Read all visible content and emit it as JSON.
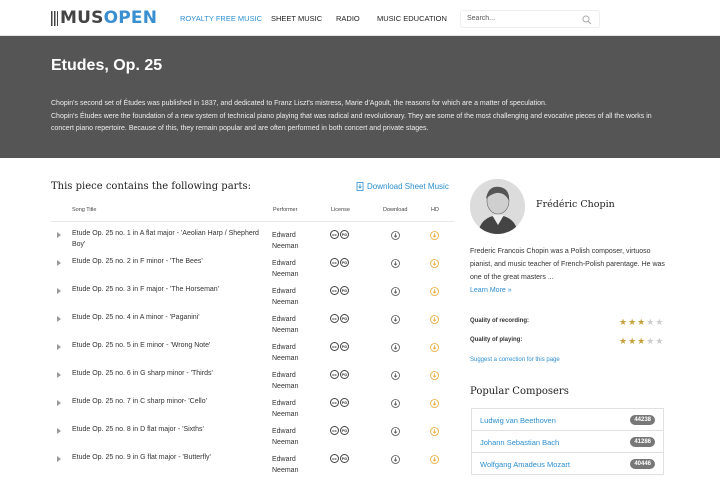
{
  "header": {
    "logo_primary": "MUS",
    "logo_accent": "OPEN",
    "nav": [
      "ROYALTY FREE MUSIC",
      "SHEET MUSIC",
      "RADIO",
      "MUSIC EDUCATION"
    ],
    "search_placeholder": "Search..."
  },
  "hero": {
    "title": "Etudes, Op. 25",
    "description_1": "Chopin's second set of Études was published in 1837, and dedicated to Franz Liszt's mistress, Marie d'Agoult, the reasons for which are a matter of speculation.",
    "description_2": "Chopin's Études were the foundation of a new system of technical piano playing that was radical and revolutionary. They are some of the most challenging and evocative pieces of all the works in concert piano repertoire. Because of this, they remain popular and are often performed in both concert and private stages."
  },
  "parts": {
    "heading": "This piece contains the following parts:",
    "download_label": "Download Sheet Music",
    "columns": [
      "Song Title",
      "Performer",
      "License",
      "Download",
      "HD"
    ],
    "license_badges": [
      "cc",
      "PD"
    ],
    "rows": [
      {
        "title": "Etude Op. 25 no. 1 in A flat major - 'Aeolian Harp / Shepherd Boy'",
        "performer": "Edward Neeman"
      },
      {
        "title": "Etude Op. 25 no. 2 in F minor - 'The Bees'",
        "performer": "Edward Neeman"
      },
      {
        "title": "Etude Op. 25 no. 3 in F major - 'The Horseman'",
        "performer": "Edward Neeman"
      },
      {
        "title": "Etude Op. 25 no. 4 in A minor - 'Paganini'",
        "performer": "Edward Neeman"
      },
      {
        "title": "Etude Op. 25 no. 5 in E minor - 'Wrong Note'",
        "performer": "Edward Neeman"
      },
      {
        "title": "Etude Op. 25 no. 6 in G sharp minor - 'Thirds'",
        "performer": "Edward Neeman"
      },
      {
        "title": "Etude Op. 25 no. 7 in C sharp minor- 'Cello'",
        "performer": "Edward Neeman"
      },
      {
        "title": "Etude Op. 25 no. 8 in D flat major - 'Sixths'",
        "performer": "Edward Neeman"
      },
      {
        "title": "Etude Op. 25 no. 9 in G flat major - 'Butterfly'",
        "performer": "Edward Neeman"
      }
    ]
  },
  "sidebar": {
    "composer_name": "Frédéric Chopin",
    "bio": "Frederic Francois Chopin was a Polish composer, virtuoso pianist, and music teacher of French-Polish parentage. He was one of the great masters ...",
    "learn_more": "Learn More »",
    "quality_recording_label": "Quality of recording:",
    "quality_recording_stars": 3,
    "quality_playing_label": "Quality of playing:",
    "quality_playing_stars": 3,
    "stars_max": 5,
    "suggest": "Suggest a correction for this page",
    "popular_title": "Popular Composers",
    "popular": [
      {
        "name": "Ludwig van Beethoven",
        "count": "44238"
      },
      {
        "name": "Johann Sebastian Bach",
        "count": "41286"
      },
      {
        "name": "Wolfgang Amadeus Mozart",
        "count": "40446"
      }
    ]
  },
  "colors": {
    "accent": "#2c8ed0",
    "hero_bg": "#555555",
    "star": "#c7a23c",
    "hd_icon": "#e8a835"
  }
}
